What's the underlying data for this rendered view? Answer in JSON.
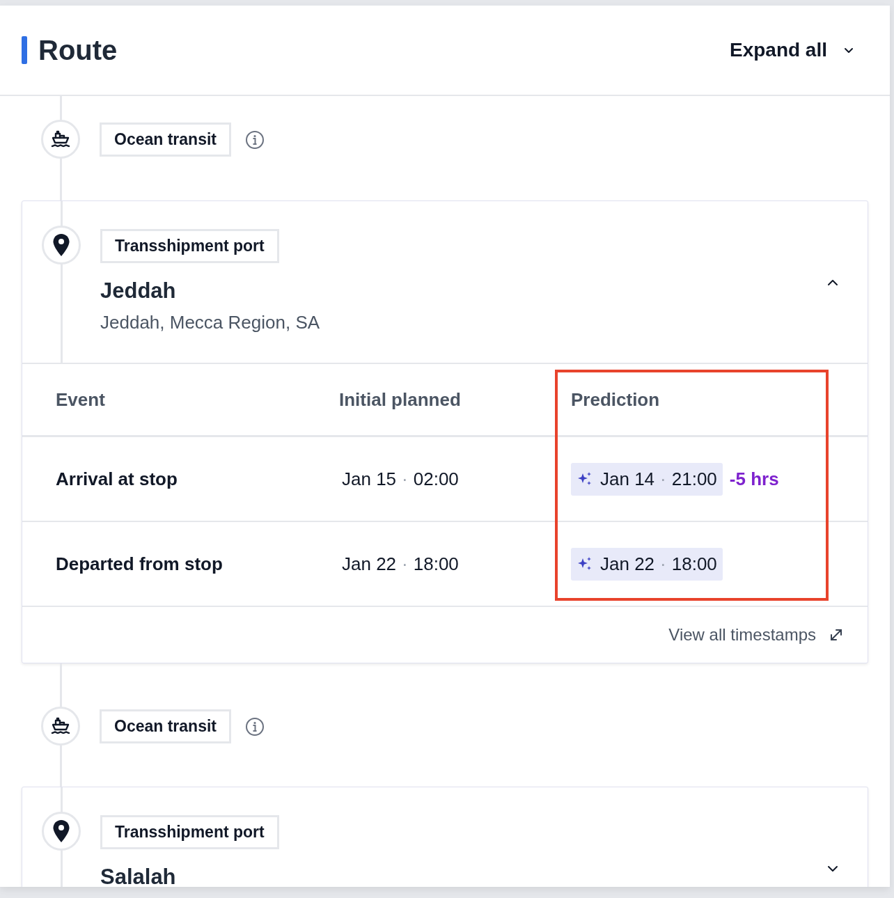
{
  "header": {
    "title": "Route",
    "expand_all": "Expand all"
  },
  "route": [
    {
      "kind": "transit",
      "label": "Ocean transit"
    },
    {
      "kind": "stop",
      "label": "Transshipment port",
      "name": "Jeddah",
      "address": "Jeddah, Mecca Region, SA",
      "expanded": true,
      "columns": [
        "Event",
        "Initial planned",
        "Prediction"
      ],
      "events": [
        {
          "event": "Arrival at stop",
          "initial": {
            "date": "Jan 15",
            "separator": "·",
            "time": "02:00"
          },
          "prediction": {
            "date": "Jan 14",
            "separator": "·",
            "time": "21:00"
          },
          "delta": "-5 hrs"
        },
        {
          "event": "Departed from stop",
          "initial": {
            "date": "Jan 22",
            "separator": "·",
            "time": "18:00"
          },
          "prediction": {
            "date": "Jan 22",
            "separator": "·",
            "time": "18:00"
          }
        }
      ],
      "footer_link": "View all timestamps"
    },
    {
      "kind": "transit",
      "label": "Ocean transit"
    },
    {
      "kind": "stop",
      "label": "Transshipment port",
      "name": "Salalah",
      "expanded": false
    }
  ]
}
